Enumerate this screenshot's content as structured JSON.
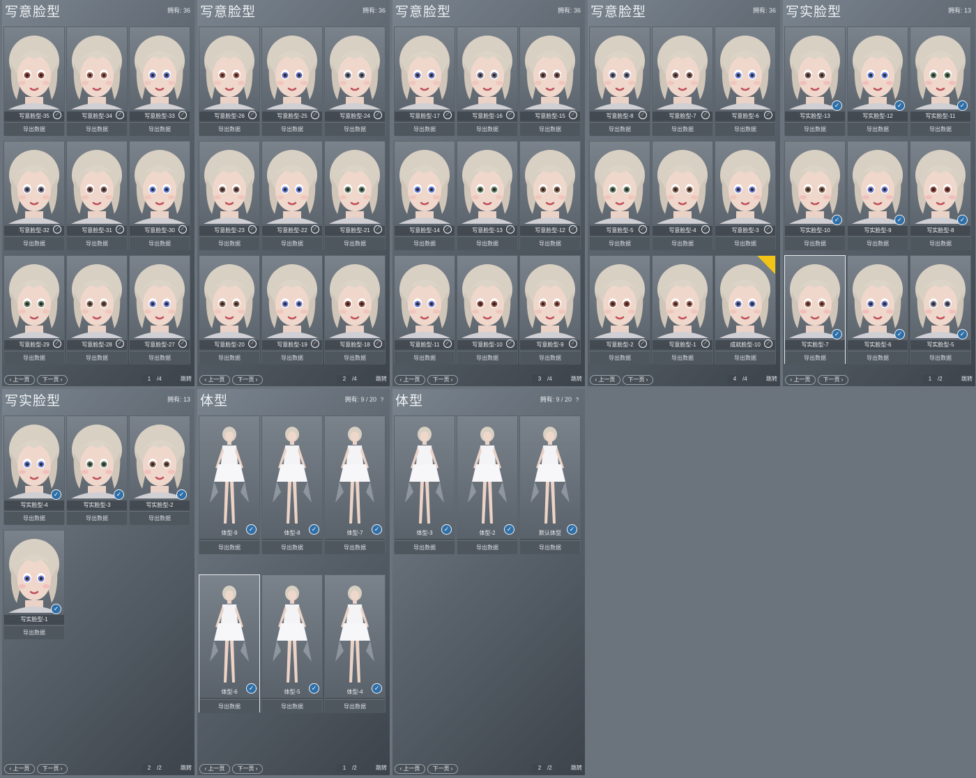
{
  "common": {
    "export_label": "导出数据",
    "prev_label": "上一页",
    "next_label": "下一页",
    "jump_label": "跳转"
  },
  "panels": [
    {
      "title": "写意脸型",
      "count": "拥有: 36",
      "page": "1",
      "total": "/4",
      "cards": [
        "写意脸型-35",
        "写意脸型-34",
        "写意脸型-33",
        "写意脸型-32",
        "写意脸型-31",
        "写意脸型-30",
        "写意脸型-29",
        "写意脸型-28",
        "写意脸型-27"
      ]
    },
    {
      "title": "写意脸型",
      "count": "拥有: 36",
      "page": "2",
      "total": "/4",
      "cards": [
        "写意脸型-26",
        "写意脸型-25",
        "写意脸型-24",
        "写意脸型-23",
        "写意脸型-22",
        "写意脸型-21",
        "写意脸型-20",
        "写意脸型-19",
        "写意脸型-18"
      ]
    },
    {
      "title": "写意脸型",
      "count": "拥有: 36",
      "page": "3",
      "total": "/4",
      "cards": [
        "写意脸型-17",
        "写意脸型-16",
        "写意脸型-15",
        "写意脸型-14",
        "写意脸型-13",
        "写意脸型-12",
        "写意脸型-11",
        "写意脸型-10",
        "写意脸型-9"
      ]
    },
    {
      "title": "写意脸型",
      "count": "拥有: 36",
      "page": "4",
      "total": "/4",
      "cards": [
        "写意脸型-8",
        "写意脸型-7",
        "写意脸型-6",
        "写意脸型-5",
        "写意脸型-4",
        "写意脸型-3",
        "写意脸型-2",
        "写意脸型-1",
        "成就脸型-10"
      ]
    },
    {
      "title": "写实脸型",
      "count": "拥有: 13",
      "page": "1",
      "total": "/2",
      "cards": [
        "写实脸型-13",
        "写实脸型-12",
        "写实脸型-11",
        "写实脸型-10",
        "写实脸型-9",
        "写实脸型-8",
        "写实脸型-7",
        "写实脸型-6",
        "写实脸型-5"
      ]
    },
    {
      "title": "写实脸型",
      "count": "拥有: 13",
      "page": "2",
      "total": "/2",
      "cards": [
        "写实脸型-4",
        "写实脸型-3",
        "写实脸型-2",
        "写实脸型-1"
      ]
    },
    {
      "title": "体型",
      "count": "拥有: 9 / 20",
      "page": "1",
      "total": "/2",
      "cards": [
        "体型-9",
        "体型-8",
        "体型-7",
        "体型-6",
        "体型-5",
        "体型-4"
      ]
    },
    {
      "title": "体型",
      "count": "拥有: 9 / 20",
      "page": "2",
      "total": "/2",
      "cards": [
        "体型-3",
        "体型-2",
        "默认体型"
      ]
    }
  ],
  "icons": {
    "owned_badge": "brush-check-icon",
    "help": "question-icon"
  },
  "colors": {
    "panel_bg": "#5b646d",
    "card_bg": "#4a5159",
    "hair": "#d8cfc3",
    "skin": "#ecd4c8",
    "accent": "#2f6fa8",
    "corner_badge": "#f2c418"
  }
}
